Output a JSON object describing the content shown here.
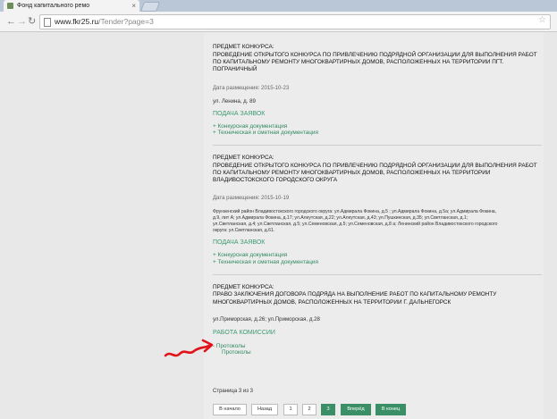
{
  "browser": {
    "tab_title": "Фонд капитального ремо",
    "url_host": "www.fkr25.ru",
    "url_path": "/Tender?page=3"
  },
  "tenders": [
    {
      "subject_label": "ПРЕДМЕТ КОНКУРСА:",
      "subject_lines": [
        "ПРОВЕДЕНИЕ ОТКРЫТОГО КОНКУРСА ПО ПРИВЛЕЧЕНИЮ ПОДРЯДНОЙ ОРГАНИЗАЦИИ ДЛЯ ВЫПОЛНЕНИЯ РАБОТ",
        "ПО КАПИТАЛЬНОМУ РЕМОНТУ МНОГОКВАРТИРНЫХ ДОМОВ, РАСПОЛОЖЕННЫХ НА ТЕРРИТОРИИ ПГТ.",
        "ПОГРАНИЧНЫЙ"
      ],
      "date": "Дата размещения: 2015-10-23",
      "address_lines": [
        "ул. Ленина, д. 89"
      ],
      "section": "ПОДАЧА ЗАЯВОК",
      "links": [
        "+ Конкурсная документация",
        "+ Техническая и сметная документация"
      ]
    },
    {
      "subject_label": "ПРЕДМЕТ КОНКУРСА:",
      "subject_lines": [
        "ПРОВЕДЕНИЕ ОТКРЫТОГО КОНКУРСА ПО ПРИВЛЕЧЕНИЮ ПОДРЯДНОЙ ОРГАНИЗАЦИИ ДЛЯ ВЫПОЛНЕНИЯ РАБОТ",
        "ПО КАПИТАЛЬНОМУ РЕМОНТУ МНОГОКВАРТИРНЫХ ДОМОВ, РАСПОЛОЖЕННЫХ НА ТЕРРИТОРИИ",
        "ВЛАДИВОСТОКСКОГО ГОРОДСКОГО ОКРУГА"
      ],
      "date": "Дата размещения: 2015-10-19",
      "address_lines": [
        "Фрунзенский район Владивостокского городского округа: ул.Адмирала Фокина, д.5 ; ул.Адмирала Фокина, д.5а; ул.Адмирала Фокина,",
        "д.9, лит А; ул.Адмирала Фокина, д.17; ул.Алеутская, д.22; ул.Алеутская, д.43; ул.Пушкинская, д.35; ул.Светланская, д.1;",
        "ул.Светланская, д.4; ул.Светланская, д.5; ул.Семеновская, д.5; ул.Семеновская, д.8 а; Ленинский район Владивостокского городского",
        "округа: ул.Светланская, д.61."
      ],
      "section": "ПОДАЧА ЗАЯВОК",
      "links": [
        "+ Конкурсная документация",
        "+ Техническая и сметная документация"
      ]
    },
    {
      "subject_label": "ПРЕДМЕТ КОНКУРСА:",
      "subject_lines": [
        "ПРАВО ЗАКЛЮЧЕНИЯ ДОГОВОРА ПОДРЯДА НА ВЫПОЛНЕНИЕ РАБОТ ПО КАПИТАЛЬНОМУ РЕМОНТУ",
        "МНОГОКВАРТИРНЫХ ДОМОВ, РАСПОЛОЖЕННЫХ НА ТЕРРИТОРИИ Г. ДАЛЬНЕГОРСК"
      ],
      "address_lines": [
        "ул.Приморская, д.26; ул.Приморская, д.28"
      ],
      "section": "РАБОТА КОМИССИИ",
      "links": [
        "- Протоколы"
      ],
      "sublinks": [
        "Протоколы"
      ]
    }
  ],
  "pagination": {
    "status": "Страница 3 из 3",
    "first": "В начало",
    "prev": "Назад",
    "pages": [
      "1",
      "2",
      "3"
    ],
    "next": "Вперёд",
    "last": "В конец"
  }
}
